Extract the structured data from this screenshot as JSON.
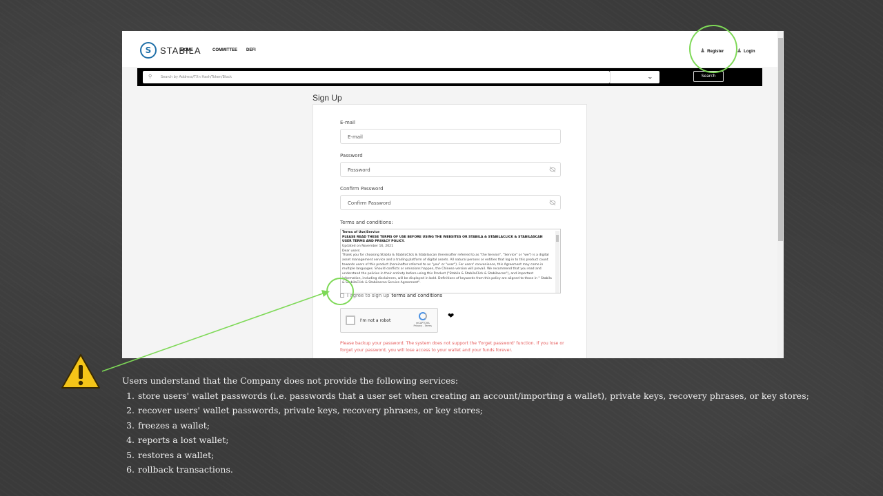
{
  "navbar": {
    "brand": "STABILA",
    "links": [
      "HOME",
      "COMMITTEE",
      "DEFI"
    ],
    "register": "Register",
    "login": "Login"
  },
  "search": {
    "placeholder": "Search by Address/TXn Hash/Token/Block",
    "button": "Search"
  },
  "form": {
    "title": "Sign Up",
    "email_label": "E-mail",
    "email_placeholder": "E-mail",
    "password_label": "Password",
    "password_placeholder": "Password",
    "confirm_label": "Confirm Password",
    "confirm_placeholder": "Confirm Password",
    "terms_label": "Terms and conditions:",
    "terms": {
      "heading": "Terms of Use/Service",
      "title": "PLEASE READ THESE TERMS OF USE BEFORE USING THE WEBSITES OR STABILA & STABILACLICK & STABILASCAN USER TERMS AND PRIVACY POLICY.",
      "updated": "Updated on November 16, 2021",
      "greeting": "Dear users:",
      "body": "Thank you for choosing Stabila & StabilaClick & Stabilascan (hereinafter referred to as \"the Service\", \"Service\" or \"we\") is a digital asset management service and a trading platform of digital assets. All natural persons or entities that log in to this product count towards users of this product (hereinafter referred to as \"you\" or \"user\"). For users' convenience, this Agreement may come in multiple languages. Should conflicts or omissions happen, the Chinese version will prevail. We recommend that you read and understand the policies in their entirety before using this Product (\"Stabila & StabilaClick & Stabilascan\"), and important information, including disclaimers, will be displayed in bold. Definitions of keywords from this policy are aligned to those in \" Stabila & StabilaClick & Stabilascan Service Agreement\"."
    },
    "agree_prefix": "I agree to sign up",
    "agree_link": "terms and conditions",
    "captcha_label": "I'm not a robot",
    "captcha_brand": "reCAPTCHA",
    "captcha_links": "Privacy - Terms",
    "warning": "Please backup your password. The system does not support the 'forget password' function. If you lose or forget your password, you will lose access to your wallet and your funds forever."
  },
  "notes": {
    "intro": "Users understand that the Company does not provide the following services:",
    "items": [
      "store users' wallet passwords (i.e. passwords that a user set when creating an account/importing a wallet), private keys, recovery phrases, or key stores;",
      "recover users' wallet passwords, private keys, recovery phrases, or key stores;",
      "freezes a wallet;",
      "reports a lost wallet;",
      "restores a wallet;",
      "rollback transactions."
    ]
  },
  "colors": {
    "highlight": "#7ed957",
    "warning_text": "#e45a5a",
    "warning_icon": "#f5c518",
    "logo": "#1e6fa8"
  },
  "icons": [
    "stabila-logo-icon",
    "register-user-icon",
    "login-user-icon",
    "search-icon",
    "chevron-down-icon",
    "eye-off-icon",
    "warning-triangle-icon",
    "heart-icon"
  ]
}
